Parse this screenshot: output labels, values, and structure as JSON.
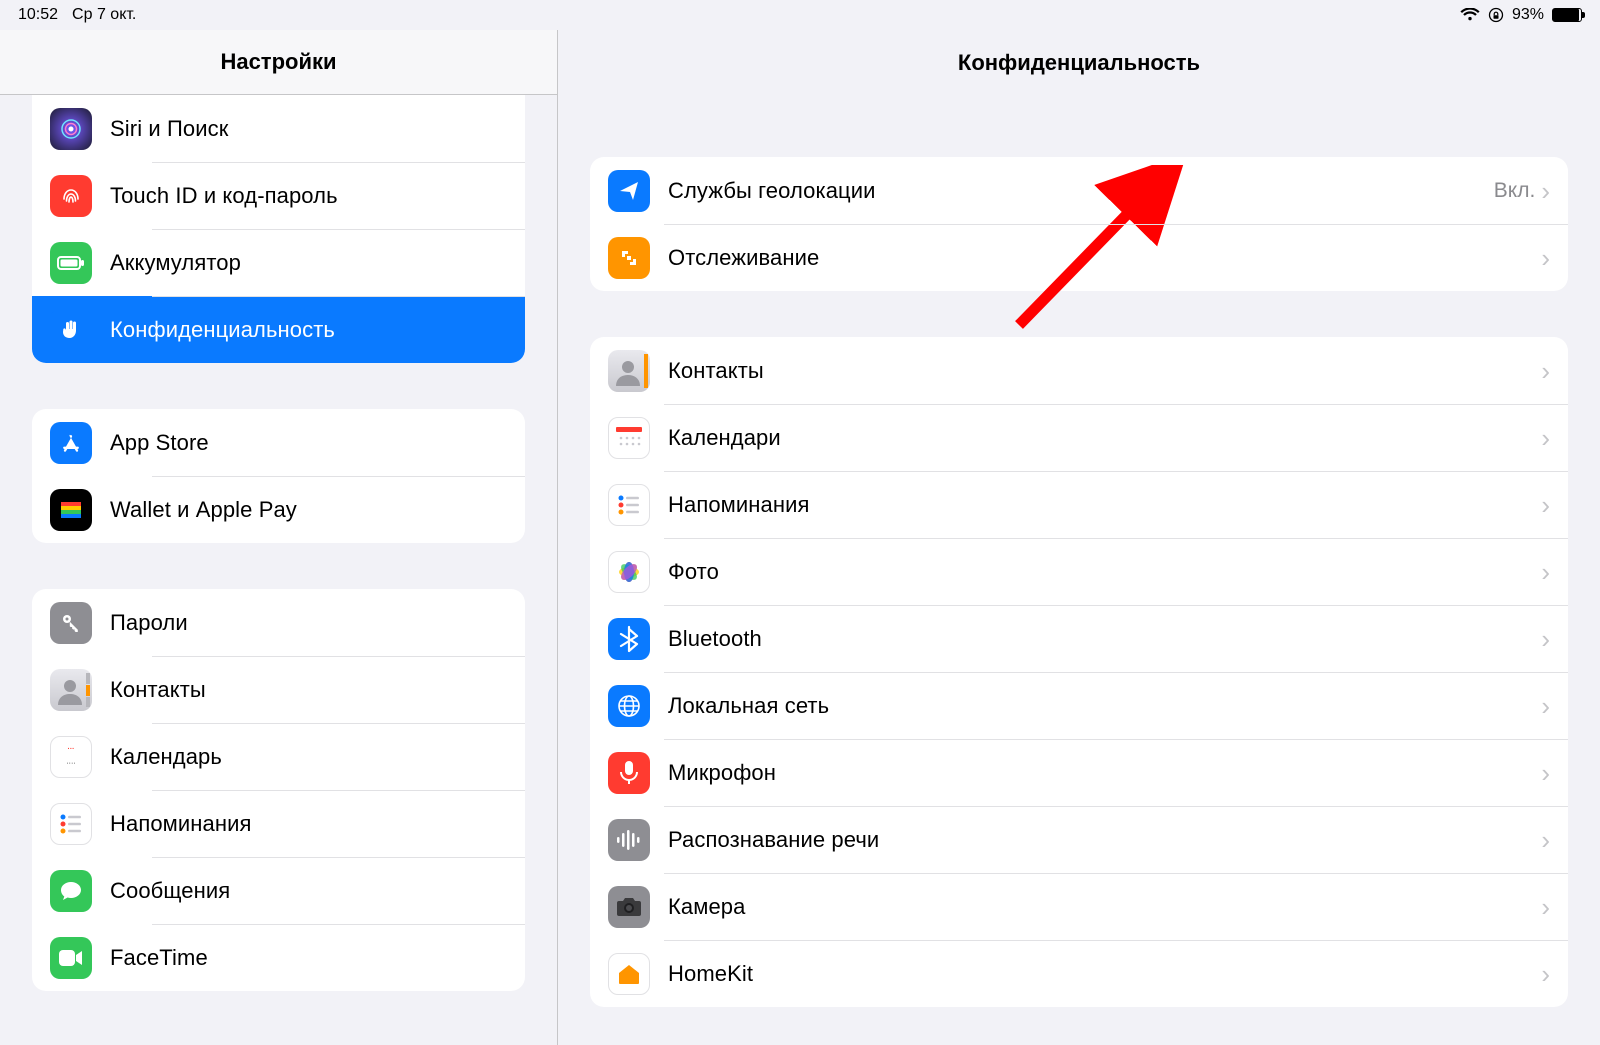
{
  "status": {
    "time": "10:52",
    "date": "Ср 7 окт.",
    "battery": "93%"
  },
  "sidebar": {
    "title": "Настройки",
    "g0": [
      {
        "label": "Siri и Поиск"
      },
      {
        "label": "Touch ID и код-пароль"
      },
      {
        "label": "Аккумулятор"
      },
      {
        "label": "Конфиденциальность"
      }
    ],
    "g1": [
      {
        "label": "App Store"
      },
      {
        "label": "Wallet и Apple Pay"
      }
    ],
    "g2": [
      {
        "label": "Пароли"
      },
      {
        "label": "Контакты"
      },
      {
        "label": "Календарь"
      },
      {
        "label": "Напоминания"
      },
      {
        "label": "Сообщения"
      },
      {
        "label": "FaceTime"
      }
    ]
  },
  "detail": {
    "title": "Конфиденциальность",
    "g0": [
      {
        "label": "Службы геолокации",
        "value": "Вкл."
      },
      {
        "label": "Отслеживание"
      }
    ],
    "g1": [
      {
        "label": "Контакты"
      },
      {
        "label": "Календари"
      },
      {
        "label": "Напоминания"
      },
      {
        "label": "Фото"
      },
      {
        "label": "Bluetooth"
      },
      {
        "label": "Локальная сеть"
      },
      {
        "label": "Микрофон"
      },
      {
        "label": "Распознавание речи"
      },
      {
        "label": "Камера"
      },
      {
        "label": "HomeKit"
      }
    ]
  }
}
